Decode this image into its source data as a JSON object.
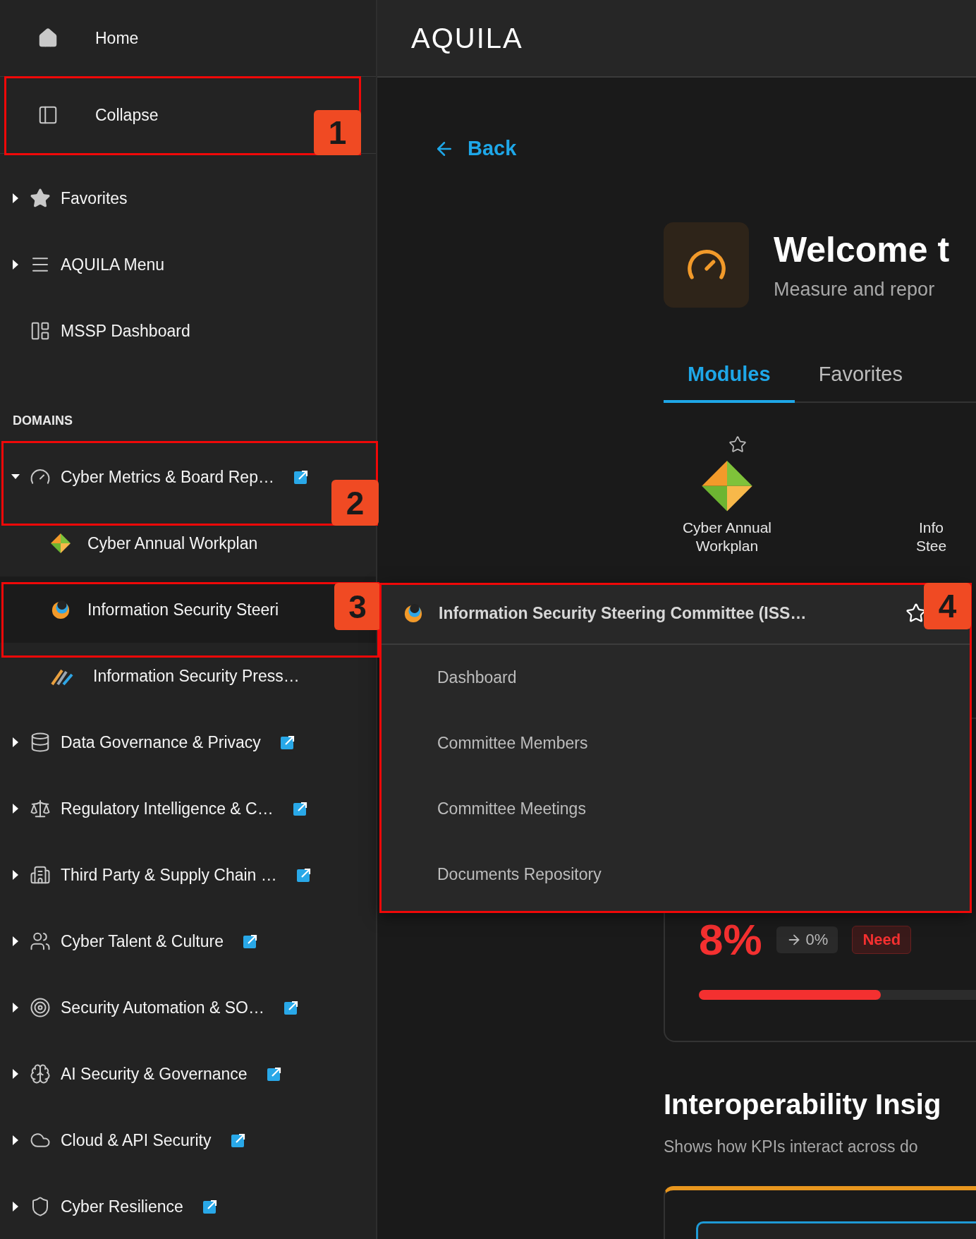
{
  "header": {
    "logo": "AQUILA"
  },
  "sidebar": {
    "top_items": [
      {
        "label": "Home"
      },
      {
        "label": "Collapse"
      }
    ],
    "nav_items": [
      {
        "label": "Favorites",
        "kind": "group",
        "expanded": false
      },
      {
        "label": "AQUILA Menu",
        "kind": "group",
        "expanded": false
      },
      {
        "label": "MSSP Dashboard",
        "kind": "link"
      }
    ],
    "section_label": "DOMAINS",
    "domains": [
      {
        "label": "Cyber Metrics & Board Rep…",
        "expanded": true,
        "children": [
          {
            "label": "Cyber Annual Workplan",
            "selected": false
          },
          {
            "label": "Information Security Steeri",
            "selected": true
          },
          {
            "label": "Information Security Press…",
            "selected": false
          }
        ]
      },
      {
        "label": "Data Governance & Privacy",
        "expanded": false
      },
      {
        "label": "Regulatory Intelligence & C…",
        "expanded": false
      },
      {
        "label": "Third Party & Supply Chain …",
        "expanded": false
      },
      {
        "label": "Cyber Talent & Culture",
        "expanded": false
      },
      {
        "label": "Security Automation & SO…",
        "expanded": false
      },
      {
        "label": "AI Security & Governance",
        "expanded": false
      },
      {
        "label": "Cloud & API Security",
        "expanded": false
      },
      {
        "label": "Cyber Resilience",
        "expanded": false
      }
    ]
  },
  "back_link": "Back",
  "welcome": {
    "title": "Welcome t",
    "subtitle": "Measure and repor"
  },
  "tabs": [
    {
      "label": "Modules",
      "selected": true
    },
    {
      "label": "Favorites",
      "selected": false
    }
  ],
  "modules": [
    {
      "label": "Cyber Annual Workplan",
      "kind": "full",
      "favorite": false
    },
    {
      "label": "Info Stee",
      "kind": "clipped"
    }
  ],
  "popup": {
    "title": "Information Security Steering Committee (ISS…",
    "favorite": false,
    "items": [
      "Dashboard",
      "Committee Members",
      "Committee Meetings",
      "Documents Repository"
    ]
  },
  "kpi_card": {
    "value": "8%",
    "trend": "0%",
    "status": "Need",
    "level": 0.6
  },
  "insights": {
    "title": "Interoperability Insig",
    "subtitle": "Shows how KPIs interact across do"
  },
  "callouts": [
    {
      "number": "1"
    },
    {
      "number": "2"
    },
    {
      "number": "3"
    },
    {
      "number": "4"
    }
  ]
}
